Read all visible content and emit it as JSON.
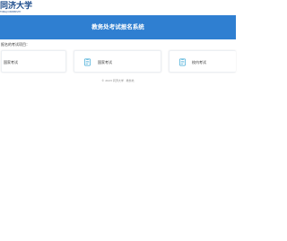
{
  "header": {
    "logo_cn": "同济大学",
    "logo_en": "TONGJI UNIVERSITY"
  },
  "banner": {
    "title": "教务处考试报名系统"
  },
  "main": {
    "section_label": "报名的考试项目：",
    "cards": [
      {
        "label": "国家考试",
        "icon": "none"
      },
      {
        "label": "国家考试",
        "icon": "exam-form-icon"
      },
      {
        "label": "校内考试",
        "icon": "exam-form-icon"
      }
    ]
  },
  "footer": {
    "text": "© 2023 同济大学 · 教务处"
  },
  "colors": {
    "banner": "#2f7fd1",
    "icon": "#3fa9d6",
    "logo": "#1a4a8a"
  }
}
